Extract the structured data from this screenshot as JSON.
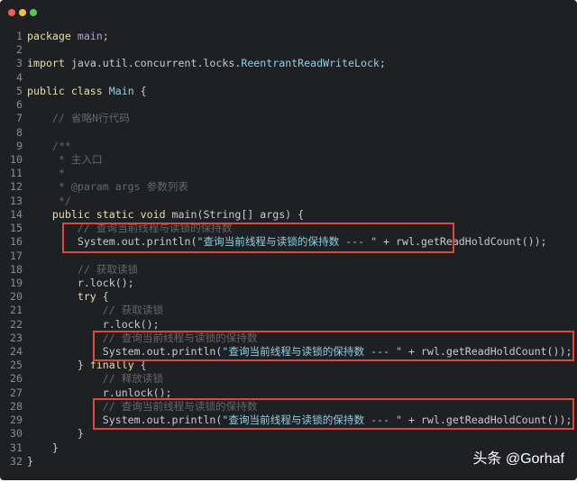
{
  "window": {
    "controls": [
      {
        "name": "close",
        "color": "#ee5f57"
      },
      {
        "name": "minimize",
        "color": "#f5bd4f"
      },
      {
        "name": "maximize",
        "color": "#5fc553"
      }
    ]
  },
  "code_lines": [
    [
      [
        "kw",
        "package "
      ],
      [
        "pk",
        "main"
      ],
      [
        "pl",
        ";"
      ]
    ],
    [],
    [
      [
        "kw",
        "import "
      ],
      [
        "pl",
        "java.util.concurrent.locks."
      ],
      [
        "cls",
        "ReentrantReadWriteLock"
      ],
      [
        "pl",
        ";"
      ]
    ],
    [],
    [
      [
        "kw",
        "public class "
      ],
      [
        "cls",
        "Main"
      ],
      [
        "pl",
        " {"
      ]
    ],
    [],
    [
      [
        "cm",
        "    // 省略N行代码"
      ]
    ],
    [],
    [
      [
        "cm",
        "    /**"
      ]
    ],
    [
      [
        "cm",
        "     * 主入口"
      ]
    ],
    [
      [
        "cm",
        "     *"
      ]
    ],
    [
      [
        "cm",
        "     * @param args 参数列表"
      ]
    ],
    [
      [
        "cm",
        "     */"
      ]
    ],
    [
      [
        "kw",
        "    public static void "
      ],
      [
        "pl",
        "main(String[] args) {"
      ]
    ],
    [
      [
        "cm",
        "        // 查询当前线程与读锁的保持数"
      ]
    ],
    [
      [
        "pl",
        "        System.out.println("
      ],
      [
        "str",
        "\"查询当前线程与读锁的保持数 --- \""
      ],
      [
        "pl",
        " + rwl.getReadHoldCount());"
      ]
    ],
    [],
    [
      [
        "cm",
        "        // 获取读锁"
      ]
    ],
    [
      [
        "pl",
        "        r.lock();"
      ]
    ],
    [
      [
        "kw",
        "        try"
      ],
      [
        "pl",
        " {"
      ]
    ],
    [
      [
        "cm",
        "            // 获取读锁"
      ]
    ],
    [
      [
        "pl",
        "            r.lock();"
      ]
    ],
    [
      [
        "cm",
        "            // 查询当前线程与读锁的保持数"
      ]
    ],
    [
      [
        "pl",
        "            System.out.println("
      ],
      [
        "str",
        "\"查询当前线程与读锁的保持数 --- \""
      ],
      [
        "pl",
        " + rwl.getReadHoldCount());"
      ]
    ],
    [
      [
        "pl",
        "        } "
      ],
      [
        "kw",
        "finally"
      ],
      [
        "pl",
        " {"
      ]
    ],
    [
      [
        "cm",
        "            // 释放读锁"
      ]
    ],
    [
      [
        "pl",
        "            r.unlock();"
      ]
    ],
    [
      [
        "cm",
        "            // 查询当前线程与读锁的保持数"
      ]
    ],
    [
      [
        "pl",
        "            System.out.println("
      ],
      [
        "str",
        "\"查询当前线程与读锁的保持数 --- \""
      ],
      [
        "pl",
        " + rwl.getReadHoldCount());"
      ]
    ],
    [
      [
        "pl",
        "        }"
      ]
    ],
    [
      [
        "pl",
        "    }"
      ]
    ],
    [
      [
        "pl",
        "}"
      ]
    ]
  ],
  "highlight_boxes": [
    {
      "lines": [
        15,
        16
      ]
    },
    {
      "lines": [
        23,
        24
      ]
    },
    {
      "lines": [
        28,
        29
      ]
    }
  ],
  "watermark": "头条 @Gorhaf"
}
